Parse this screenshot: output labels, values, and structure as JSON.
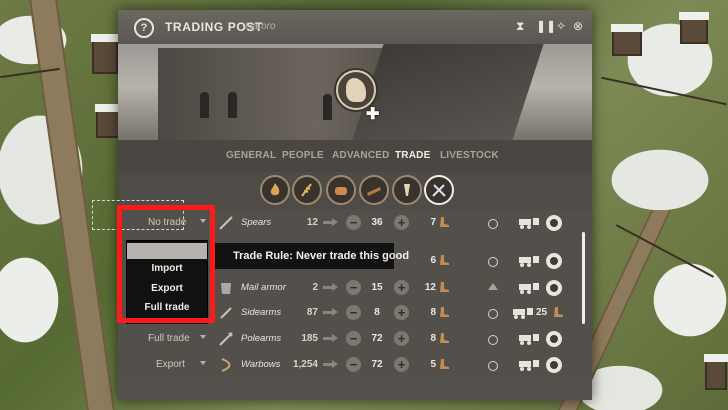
{
  "window": {
    "title": "TRADING POST",
    "subtitle": "Haroro"
  },
  "tabs": [
    {
      "label": "GENERAL",
      "active": false
    },
    {
      "label": "PEOPLE",
      "active": false
    },
    {
      "label": "ADVANCED",
      "active": false
    },
    {
      "label": "TRADE",
      "active": true
    },
    {
      "label": "LIVESTOCK",
      "active": false
    }
  ],
  "categories": [
    {
      "icon": "fire-icon",
      "active": false
    },
    {
      "icon": "wheat-icon",
      "active": false
    },
    {
      "icon": "bread-icon",
      "active": false
    },
    {
      "icon": "planks-icon",
      "active": false
    },
    {
      "icon": "tools-icon",
      "active": false
    },
    {
      "icon": "weapons-icon",
      "active": true
    }
  ],
  "rows": [
    {
      "rule": "No trade",
      "name": "Spears",
      "stock": "12",
      "target": "36",
      "qty": "7",
      "status": "circle",
      "cart_count": ""
    },
    {
      "rule": "",
      "name": "",
      "stock": "",
      "target": "",
      "qty": "6",
      "status": "circle",
      "cart_count": ""
    },
    {
      "rule": "",
      "name": "Mail armor",
      "stock": "2",
      "target": "15",
      "qty": "12",
      "status": "arrow",
      "cart_count": ""
    },
    {
      "rule": "",
      "name": "Sidearms",
      "stock": "87",
      "target": "8",
      "qty": "8",
      "status": "circle",
      "cart_count": "25"
    },
    {
      "rule": "Full trade",
      "name": "Polearms",
      "stock": "185",
      "target": "72",
      "qty": "8",
      "status": "circle",
      "cart_count": ""
    },
    {
      "rule": "Export",
      "name": "Warbows",
      "stock": "1,254",
      "target": "72",
      "qty": "5",
      "status": "circle",
      "cart_count": ""
    }
  ],
  "dropdown": {
    "options": [
      "Import",
      "Export",
      "Full trade"
    ]
  },
  "tooltip": {
    "text": "Trade Rule: Never trade this good"
  },
  "colors": {
    "highlight": "#ff1a1a",
    "panel": "#55524d",
    "active_text": "#f2eee6"
  }
}
